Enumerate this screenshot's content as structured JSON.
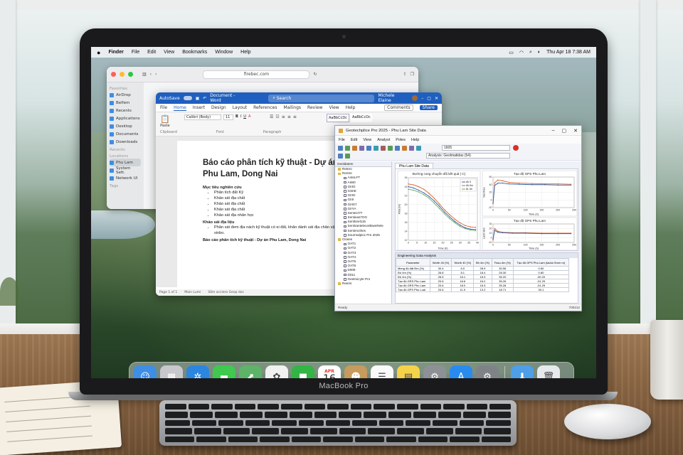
{
  "menubar": {
    "apple": "",
    "app_name": "Finder",
    "items": [
      "File",
      "Edit",
      "View",
      "Bookmarks",
      "Window",
      "Help"
    ],
    "datetime": "Thu Apr 18  7:38 AM"
  },
  "finder": {
    "address": "firebec.com",
    "favorites_header": "Favorites",
    "locations_header": "Locations",
    "tags_header": "Tags",
    "items": [
      "AirDrop",
      "Belfem",
      "Recents",
      "Applications",
      "Desktop",
      "Documents",
      "Downloads"
    ],
    "recents_header": "Recents",
    "location_items": [
      "Phu Lam",
      "System Sett.",
      "Network UI"
    ]
  },
  "word": {
    "autosave": "AutoSave",
    "doc_title": "Document - Word",
    "search": "Search",
    "user": "Michele Elaine",
    "tabs": [
      "File",
      "Home",
      "Insert",
      "Design",
      "Layout",
      "References",
      "Mailings",
      "Review",
      "View",
      "Help"
    ],
    "comments": "Comments",
    "share": "Share",
    "paste": "Paste",
    "font": "Calibri (Body)",
    "size": "11",
    "groups": [
      "Clipboard",
      "Font",
      "Paragraph"
    ],
    "styles": [
      "AaBbCcDc",
      "AaBbCcDc"
    ],
    "heading": "Báo cáo phân tích kỹ thuật - Dự án Phu Lam, Dong Nai",
    "section1": "Mục tiêu nghiên cứu",
    "bullets1": [
      "Phân tích đất Kỹ",
      "Khảo sát địa chất",
      "Khảo sát địa chất",
      "Khảo sát địa chất",
      "Khảo sát địa nhân học"
    ],
    "section2": "Khảo sát địa liệu",
    "bullets2": [
      "Phân sát đem địa nách kỹ thuật có ei đất, khăn dành sát địa chân vật dần sinbo."
    ],
    "footer_line": "Báo cáo phân tích kỹ thuật - Dự án Phu Lam, Dong Nai",
    "status": [
      "Page 1 of 1",
      "Main Lumi",
      "Sắm accless Geop doc"
    ]
  },
  "geo": {
    "title": "Geotechplice Pro 2025 - Phu Lam Site Data",
    "menu": [
      "File",
      "Edit",
      "View",
      "Analyst",
      "Poles",
      "Help"
    ],
    "sample": "1605",
    "analysis": "Analysis: Geolmatidas (54)",
    "tree_header": "Geoldatem",
    "tree": [
      {
        "label": "Retero",
        "top": true
      },
      {
        "label": "Rentre",
        "top": true
      },
      {
        "label": "AnteLFT"
      },
      {
        "label": "AIW0"
      },
      {
        "label": "GIIIO"
      },
      {
        "label": "GSIIE"
      },
      {
        "label": "GIIIO"
      },
      {
        "label": "GIIII"
      },
      {
        "label": "GIIIS7"
      },
      {
        "label": "GIIYA"
      },
      {
        "label": "Sentect7T"
      },
      {
        "label": "Sentieas7OG"
      },
      {
        "label": "Sentlorel115"
      },
      {
        "label": "SentirantelecerBiwnRele"
      },
      {
        "label": "Sentirncthes"
      },
      {
        "label": "Sourmalpioc Pre 2025"
      },
      {
        "label": "Closes",
        "top": true
      },
      {
        "label": "OAT1"
      },
      {
        "label": "OAT2"
      },
      {
        "label": "OAT3"
      },
      {
        "label": "OAT4"
      },
      {
        "label": "OAT5"
      },
      {
        "label": "OAT6"
      },
      {
        "label": "D009"
      },
      {
        "label": "D011"
      },
      {
        "label": "Geetrxicyte Pro"
      },
      {
        "label": "Reeris",
        "top": true
      }
    ],
    "doc_tab": "Phu Lam Site Data",
    "table_header": "Engineering Gata Analysis",
    "table": {
      "columns": [
        "Parameter",
        "Worth 40 (%)",
        "Worth 40 (%)",
        "Bh 4m (%)",
        "Fasu.4m (%)",
        "Tạo độ GPS Phu Lam (lavda Srnm m)"
      ],
      "rows": [
        [
          "Meng độ đất Đm (%)",
          "30.4",
          "6.0",
          "28.9",
          "30.56",
          "0.60"
        ],
        [
          "Đô 4m (%)",
          "26.8",
          "8.1",
          "18.4",
          "28.30",
          "0.80"
        ],
        [
          "Độ 4m (%)",
          "26.5",
          "16.1",
          "18.3",
          "35.20",
          "-00.20"
        ],
        [
          "Tạo độ GRS Phu Lam",
          "20.6",
          "16.6",
          "16.2",
          "35.26",
          "-01.29"
        ],
        [
          "Tạo độ GRS Phu Lam",
          "20.6",
          "18.0",
          "18.3",
          "35.28",
          "-01.29"
        ],
        [
          "Tạo độ GPS Phu Lual",
          "20.6",
          "11.9",
          "13.2",
          "18.71",
          "30.1"
        ]
      ]
    },
    "status_left": "Ready",
    "status_right": "700212"
  },
  "chart_data": [
    {
      "type": "line",
      "title": "Đường cong chuyển đổi kết quả ( C)",
      "xlabel": "Time (h)",
      "ylabel": "Rhd (%)",
      "xlim": [
        0,
        40
      ],
      "ylim": [
        12,
        26
      ],
      "x_ticks": [
        0,
        5,
        10,
        15,
        20,
        25,
        30,
        35,
        40
      ],
      "y_ticks": [
        12,
        14,
        16,
        18,
        20,
        22,
        24,
        26
      ],
      "legend_position": "top-right",
      "series": [
        {
          "name": "độ 5",
          "color": "#2f5fa8",
          "x": [
            0,
            3,
            6,
            9,
            12,
            15,
            18,
            21,
            24,
            27,
            30,
            33,
            36,
            39
          ],
          "y": [
            24.0,
            23.7,
            23.2,
            22.6,
            21.8,
            20.8,
            19.6,
            18.3,
            17.2,
            16.2,
            15.4,
            14.8,
            14.5,
            14.4
          ]
        },
        {
          "name": "độ 6m",
          "color": "#d9622b",
          "x": [
            0,
            3,
            6,
            9,
            12,
            15,
            18,
            21,
            24,
            27,
            30,
            33,
            36,
            39
          ],
          "y": [
            24.6,
            24.4,
            24.0,
            23.4,
            22.5,
            21.4,
            20.1,
            18.8,
            17.7,
            16.7,
            15.9,
            15.3,
            15.0,
            14.9
          ]
        },
        {
          "name": "8L 6h",
          "color": "#6aa86a",
          "x": [
            0,
            3,
            6,
            9,
            12,
            15,
            18,
            21,
            24,
            27,
            30,
            33,
            36,
            39
          ],
          "y": [
            23.4,
            23.2,
            22.8,
            22.2,
            21.4,
            20.3,
            19.1,
            17.9,
            16.8,
            15.9,
            15.1,
            14.6,
            14.3,
            14.2
          ]
        }
      ]
    },
    {
      "type": "line",
      "title": "Tạo độ GPS Phu Lam",
      "xlabel": "Time (h)",
      "ylabel": "Gia theo",
      "xlim": [
        0,
        250
      ],
      "ylim": [
        -20,
        60
      ],
      "x_ticks": [
        0,
        50,
        100,
        150,
        200,
        250
      ],
      "y_ticks": [
        -20,
        0,
        20,
        40,
        60
      ],
      "series": [
        {
          "name": "",
          "color": "#d9622b",
          "x": [
            0,
            5,
            15,
            30,
            50,
            80,
            120,
            160,
            200,
            240
          ],
          "y": [
            -10,
            45,
            52,
            50,
            46,
            44,
            43,
            42,
            42,
            41
          ]
        },
        {
          "name": "",
          "color": "#2f5fa8",
          "x": [
            0,
            5,
            15,
            30,
            50,
            80,
            120,
            160,
            200,
            240
          ],
          "y": [
            -8,
            38,
            44,
            44,
            42,
            41,
            40,
            40,
            39,
            39
          ]
        }
      ]
    },
    {
      "type": "line",
      "title": "Tạo độ GPS Phu Lam",
      "xlabel": "Time (h)",
      "ylabel": "Lệch tâm",
      "xlim": [
        0,
        250
      ],
      "ylim": [
        -10,
        30
      ],
      "x_ticks": [
        0,
        50,
        100,
        150,
        200,
        250
      ],
      "y_ticks": [
        -10,
        0,
        10,
        20,
        30
      ],
      "series": [
        {
          "name": "",
          "color": "#d9622b",
          "x": [
            0,
            5,
            15,
            30,
            60,
            100,
            150,
            200,
            240
          ],
          "y": [
            -5,
            20,
            14,
            12,
            11,
            11,
            10,
            10,
            10
          ]
        },
        {
          "name": "",
          "color": "#2f5fa8",
          "x": [
            0,
            5,
            15,
            30,
            60,
            100,
            150,
            200,
            240
          ],
          "y": [
            -3,
            16,
            12,
            11,
            10,
            10,
            9,
            9,
            9
          ]
        }
      ]
    }
  ],
  "calendar_day": "16",
  "calendar_month": "APR",
  "brand": "MacBook Pro",
  "dock": [
    {
      "name": "finder",
      "color": "#3f8ee6",
      "glyph": "☺"
    },
    {
      "name": "launchpad",
      "color": "#c8c8cc",
      "glyph": "▦"
    },
    {
      "name": "safari",
      "color": "#2b86e0",
      "glyph": "✲"
    },
    {
      "name": "messages",
      "color": "#3fc94f",
      "glyph": "▬"
    },
    {
      "name": "maps",
      "color": "#5db368",
      "glyph": "⬈"
    },
    {
      "name": "photos",
      "color": "#f1f1f1",
      "glyph": "✿"
    },
    {
      "name": "facetime",
      "color": "#33b545",
      "glyph": "■"
    },
    {
      "name": "calendar",
      "color": "#ffffff",
      "glyph": ""
    },
    {
      "name": "contacts",
      "color": "#c79a5d",
      "glyph": "☻"
    },
    {
      "name": "reminders",
      "color": "#fafafa",
      "glyph": "☰"
    },
    {
      "name": "notes",
      "color": "#f4d24a",
      "glyph": "▤"
    },
    {
      "name": "system-settings",
      "color": "#8d9196",
      "glyph": "⚙"
    },
    {
      "name": "app-store",
      "color": "#2a8bef",
      "glyph": "A"
    },
    {
      "name": "settings",
      "color": "#7f8388",
      "glyph": "⚙"
    },
    {
      "name": "downloads",
      "color": "#4e9ee8",
      "glyph": "⬇"
    },
    {
      "name": "trash",
      "color": "#e7eaec",
      "glyph": "🗑"
    }
  ]
}
